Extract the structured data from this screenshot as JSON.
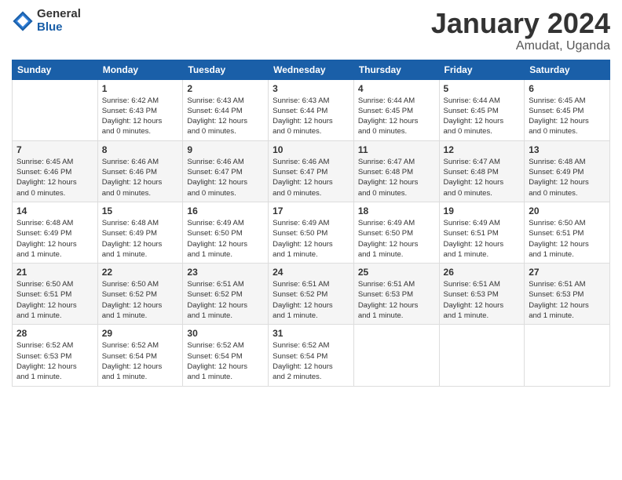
{
  "logo": {
    "general": "General",
    "blue": "Blue"
  },
  "title": {
    "month": "January 2024",
    "location": "Amudat, Uganda"
  },
  "headers": [
    "Sunday",
    "Monday",
    "Tuesday",
    "Wednesday",
    "Thursday",
    "Friday",
    "Saturday"
  ],
  "rows": [
    [
      {
        "day": "",
        "lines": []
      },
      {
        "day": "1",
        "lines": [
          "Sunrise: 6:42 AM",
          "Sunset: 6:43 PM",
          "Daylight: 12 hours",
          "and 0 minutes."
        ]
      },
      {
        "day": "2",
        "lines": [
          "Sunrise: 6:43 AM",
          "Sunset: 6:44 PM",
          "Daylight: 12 hours",
          "and 0 minutes."
        ]
      },
      {
        "day": "3",
        "lines": [
          "Sunrise: 6:43 AM",
          "Sunset: 6:44 PM",
          "Daylight: 12 hours",
          "and 0 minutes."
        ]
      },
      {
        "day": "4",
        "lines": [
          "Sunrise: 6:44 AM",
          "Sunset: 6:45 PM",
          "Daylight: 12 hours",
          "and 0 minutes."
        ]
      },
      {
        "day": "5",
        "lines": [
          "Sunrise: 6:44 AM",
          "Sunset: 6:45 PM",
          "Daylight: 12 hours",
          "and 0 minutes."
        ]
      },
      {
        "day": "6",
        "lines": [
          "Sunrise: 6:45 AM",
          "Sunset: 6:45 PM",
          "Daylight: 12 hours",
          "and 0 minutes."
        ]
      }
    ],
    [
      {
        "day": "7",
        "lines": [
          "Sunrise: 6:45 AM",
          "Sunset: 6:46 PM",
          "Daylight: 12 hours",
          "and 0 minutes."
        ]
      },
      {
        "day": "8",
        "lines": [
          "Sunrise: 6:46 AM",
          "Sunset: 6:46 PM",
          "Daylight: 12 hours",
          "and 0 minutes."
        ]
      },
      {
        "day": "9",
        "lines": [
          "Sunrise: 6:46 AM",
          "Sunset: 6:47 PM",
          "Daylight: 12 hours",
          "and 0 minutes."
        ]
      },
      {
        "day": "10",
        "lines": [
          "Sunrise: 6:46 AM",
          "Sunset: 6:47 PM",
          "Daylight: 12 hours",
          "and 0 minutes."
        ]
      },
      {
        "day": "11",
        "lines": [
          "Sunrise: 6:47 AM",
          "Sunset: 6:48 PM",
          "Daylight: 12 hours",
          "and 0 minutes."
        ]
      },
      {
        "day": "12",
        "lines": [
          "Sunrise: 6:47 AM",
          "Sunset: 6:48 PM",
          "Daylight: 12 hours",
          "and 0 minutes."
        ]
      },
      {
        "day": "13",
        "lines": [
          "Sunrise: 6:48 AM",
          "Sunset: 6:49 PM",
          "Daylight: 12 hours",
          "and 0 minutes."
        ]
      }
    ],
    [
      {
        "day": "14",
        "lines": [
          "Sunrise: 6:48 AM",
          "Sunset: 6:49 PM",
          "Daylight: 12 hours",
          "and 1 minute."
        ]
      },
      {
        "day": "15",
        "lines": [
          "Sunrise: 6:48 AM",
          "Sunset: 6:49 PM",
          "Daylight: 12 hours",
          "and 1 minute."
        ]
      },
      {
        "day": "16",
        "lines": [
          "Sunrise: 6:49 AM",
          "Sunset: 6:50 PM",
          "Daylight: 12 hours",
          "and 1 minute."
        ]
      },
      {
        "day": "17",
        "lines": [
          "Sunrise: 6:49 AM",
          "Sunset: 6:50 PM",
          "Daylight: 12 hours",
          "and 1 minute."
        ]
      },
      {
        "day": "18",
        "lines": [
          "Sunrise: 6:49 AM",
          "Sunset: 6:50 PM",
          "Daylight: 12 hours",
          "and 1 minute."
        ]
      },
      {
        "day": "19",
        "lines": [
          "Sunrise: 6:49 AM",
          "Sunset: 6:51 PM",
          "Daylight: 12 hours",
          "and 1 minute."
        ]
      },
      {
        "day": "20",
        "lines": [
          "Sunrise: 6:50 AM",
          "Sunset: 6:51 PM",
          "Daylight: 12 hours",
          "and 1 minute."
        ]
      }
    ],
    [
      {
        "day": "21",
        "lines": [
          "Sunrise: 6:50 AM",
          "Sunset: 6:51 PM",
          "Daylight: 12 hours",
          "and 1 minute."
        ]
      },
      {
        "day": "22",
        "lines": [
          "Sunrise: 6:50 AM",
          "Sunset: 6:52 PM",
          "Daylight: 12 hours",
          "and 1 minute."
        ]
      },
      {
        "day": "23",
        "lines": [
          "Sunrise: 6:51 AM",
          "Sunset: 6:52 PM",
          "Daylight: 12 hours",
          "and 1 minute."
        ]
      },
      {
        "day": "24",
        "lines": [
          "Sunrise: 6:51 AM",
          "Sunset: 6:52 PM",
          "Daylight: 12 hours",
          "and 1 minute."
        ]
      },
      {
        "day": "25",
        "lines": [
          "Sunrise: 6:51 AM",
          "Sunset: 6:53 PM",
          "Daylight: 12 hours",
          "and 1 minute."
        ]
      },
      {
        "day": "26",
        "lines": [
          "Sunrise: 6:51 AM",
          "Sunset: 6:53 PM",
          "Daylight: 12 hours",
          "and 1 minute."
        ]
      },
      {
        "day": "27",
        "lines": [
          "Sunrise: 6:51 AM",
          "Sunset: 6:53 PM",
          "Daylight: 12 hours",
          "and 1 minute."
        ]
      }
    ],
    [
      {
        "day": "28",
        "lines": [
          "Sunrise: 6:52 AM",
          "Sunset: 6:53 PM",
          "Daylight: 12 hours",
          "and 1 minute."
        ]
      },
      {
        "day": "29",
        "lines": [
          "Sunrise: 6:52 AM",
          "Sunset: 6:54 PM",
          "Daylight: 12 hours",
          "and 1 minute."
        ]
      },
      {
        "day": "30",
        "lines": [
          "Sunrise: 6:52 AM",
          "Sunset: 6:54 PM",
          "Daylight: 12 hours",
          "and 1 minute."
        ]
      },
      {
        "day": "31",
        "lines": [
          "Sunrise: 6:52 AM",
          "Sunset: 6:54 PM",
          "Daylight: 12 hours",
          "and 2 minutes."
        ]
      },
      {
        "day": "",
        "lines": []
      },
      {
        "day": "",
        "lines": []
      },
      {
        "day": "",
        "lines": []
      }
    ]
  ]
}
